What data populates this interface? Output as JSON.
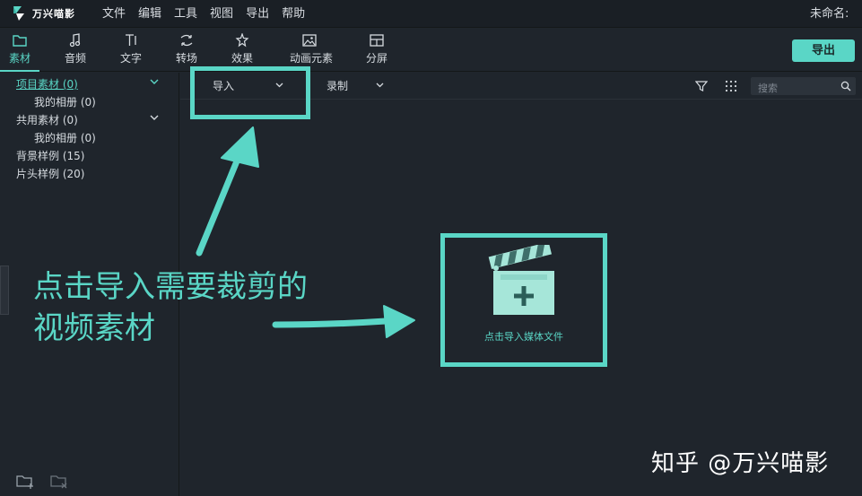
{
  "app": {
    "logo_text": "万兴喵影",
    "project_name": "未命名:"
  },
  "menu": [
    "文件",
    "编辑",
    "工具",
    "视图",
    "导出",
    "帮助"
  ],
  "toolbar": {
    "tabs": [
      {
        "label": "素材",
        "icon": "folder-icon",
        "active": true
      },
      {
        "label": "音频",
        "icon": "music-note-icon",
        "active": false
      },
      {
        "label": "文字",
        "icon": "text-icon",
        "active": false
      },
      {
        "label": "转场",
        "icon": "transition-icon",
        "active": false
      },
      {
        "label": "效果",
        "icon": "effects-icon",
        "active": false
      },
      {
        "label": "动画元素",
        "icon": "image-icon",
        "active": false
      },
      {
        "label": "分屏",
        "icon": "split-screen-icon",
        "active": false
      }
    ],
    "export_label": "导出"
  },
  "sidebar": {
    "items": [
      {
        "label": "项目素材 (0)",
        "active": true,
        "expandable": true
      },
      {
        "label": "我的相册 (0)",
        "active": false,
        "expandable": false
      },
      {
        "label": "共用素材 (0)",
        "active": false,
        "expandable": true
      },
      {
        "label": "我的相册 (0)",
        "active": false,
        "expandable": false
      },
      {
        "label": "背景样例 (15)",
        "active": false,
        "expandable": false
      },
      {
        "label": "片头样例 (20)",
        "active": false,
        "expandable": false
      }
    ]
  },
  "content_toolbar": {
    "import_label": "导入",
    "record_label": "录制",
    "search_placeholder": "搜索"
  },
  "import_media": {
    "label": "点击导入媒体文件"
  },
  "annotation": {
    "line1": "点击导入需要裁剪的",
    "line2": "视频素材"
  },
  "watermark": "知乎 @万兴喵影",
  "colors": {
    "accent": "#5ad6c6",
    "background": "#1f252c",
    "menubar": "#1a1f25"
  }
}
